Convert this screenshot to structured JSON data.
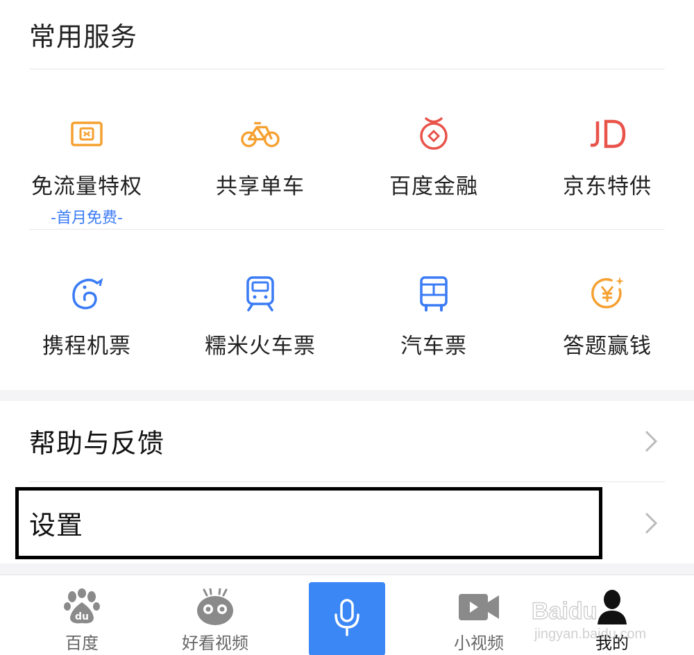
{
  "section": {
    "title": "常用服务"
  },
  "services_row1": [
    {
      "label": "免流量特权",
      "sub": "-首月免费-",
      "icon": "sim-card-icon"
    },
    {
      "label": "共享单车",
      "icon": "bicycle-icon"
    },
    {
      "label": "百度金融",
      "icon": "money-bag-icon"
    },
    {
      "label": "京东特供",
      "icon": "jd-logo-icon"
    }
  ],
  "services_row2": [
    {
      "label": "携程机票",
      "icon": "ctrip-dolphin-icon"
    },
    {
      "label": "糯米火车票",
      "icon": "train-icon"
    },
    {
      "label": "汽车票",
      "icon": "bus-icon"
    },
    {
      "label": "答题赢钱",
      "icon": "yen-coin-icon"
    }
  ],
  "menu": {
    "help": "帮助与反馈",
    "settings": "设置"
  },
  "tabbar": {
    "home": "百度",
    "video": "好看视频",
    "short_video": "小视频",
    "mine": "我的"
  },
  "colors": {
    "orange": "#f5a030",
    "red": "#e8534a",
    "blue": "#3a7bf5",
    "voice_blue": "#3a87f5"
  }
}
